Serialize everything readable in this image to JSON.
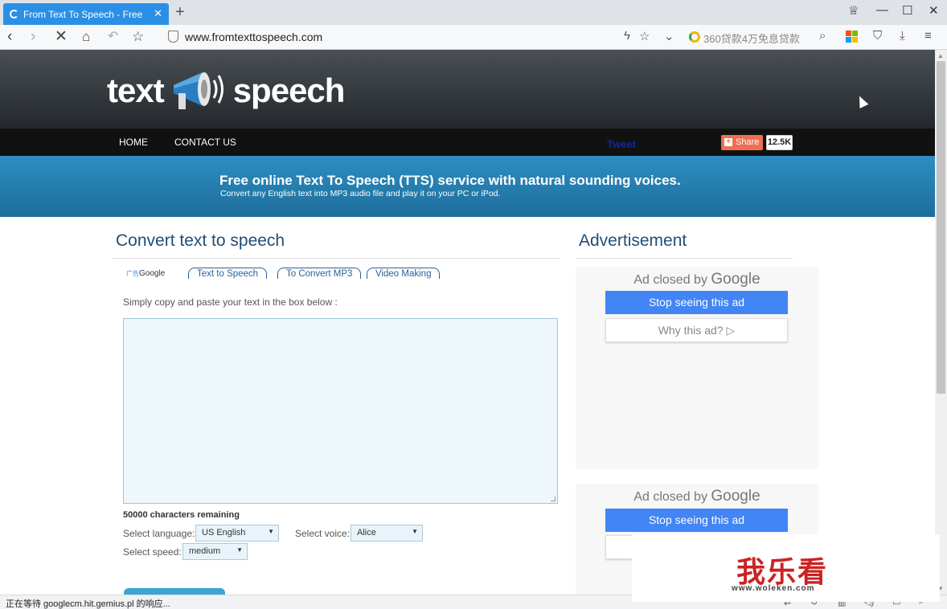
{
  "browser": {
    "tab_title": "From Text To Speech - Free",
    "tab_close": "✕",
    "new_tab": "+",
    "url": "www.fromtexttospeech.com",
    "search_text": "360贷款4万免息贷款",
    "status_text": "正在等待 googlecm.hit.gemius.pl 的响应...",
    "window_controls": [
      "skin-icon",
      "minimize-icon",
      "maximize-icon",
      "close-icon"
    ]
  },
  "site": {
    "logo_left": "text",
    "logo_right": "speech",
    "nav": [
      "HOME",
      "CONTACT US"
    ],
    "tweet": "Tweet",
    "share_label": "Share",
    "share_count": "12.5K",
    "banner_title": "Free online Text To Speech (TTS) service with natural sounding voices.",
    "banner_subtitle": "Convert any English text into MP3 audio file and play it on your PC or iPod."
  },
  "main": {
    "title": "Convert text to speech",
    "ad_label_prefix": "广告",
    "ad_label_brand": "Google",
    "tabs": [
      "Text to Speech",
      "To Convert MP3",
      "Video Making"
    ],
    "instructions": "Simply copy and paste your text in the box below :",
    "remaining": "50000 characters remaining",
    "language_label": "Select language:",
    "language_value": "US English",
    "voice_label": "Select voice:",
    "voice_value": "Alice",
    "speed_label": "Select speed:",
    "speed_value": "medium"
  },
  "sidebar": {
    "title": "Advertisement",
    "ad_closed_prefix": "Ad closed by",
    "ad_closed_brand": "Google",
    "stop_label": "Stop seeing this ad",
    "why_label": "Why this ad? ▷"
  },
  "watermark": {
    "main": "我乐看",
    "sub": "www.woleken.com"
  },
  "colors": {
    "tab_blue": "#2b8fe6",
    "banner_blue": "#2d8ec1",
    "google_blue": "#4285f4",
    "share_orange": "#ef6f52",
    "title_blue": "#1f4e79"
  }
}
